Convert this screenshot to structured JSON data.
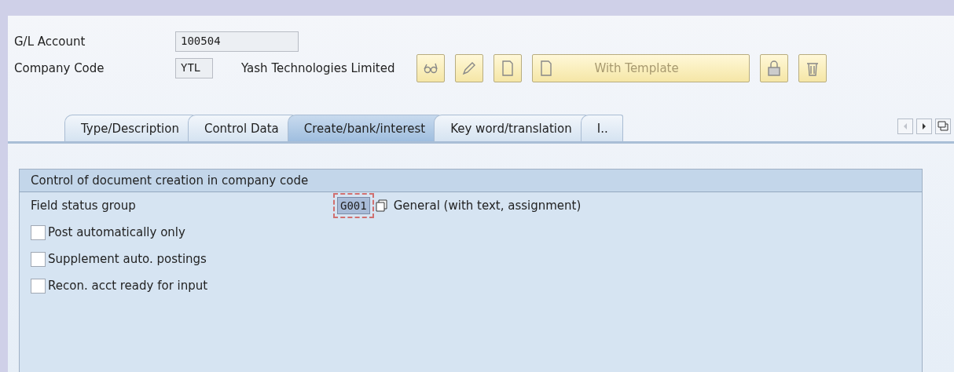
{
  "header": {
    "fields": [
      {
        "label": "G/L Account",
        "value": "100504",
        "kind": "long"
      },
      {
        "label": "Company Code",
        "value": "YTL",
        "kind": "short",
        "description": "Yash Technologies Limited"
      }
    ]
  },
  "toolbar": [
    {
      "kind": "display"
    },
    {
      "kind": "edit"
    },
    {
      "kind": "create"
    },
    {
      "kind": "template",
      "label": "With Template"
    },
    {
      "kind": "lock"
    },
    {
      "kind": "delete"
    }
  ],
  "tabs": [
    {
      "label": "Type/Description",
      "selected": false
    },
    {
      "label": "Control Data",
      "selected": false
    },
    {
      "label": "Create/bank/interest",
      "selected": true
    },
    {
      "label": "Key word/translation",
      "selected": false
    },
    {
      "label": "I..",
      "selected": false
    }
  ],
  "tab_nav": [
    {
      "kind": "prev",
      "disabled": true
    },
    {
      "kind": "next",
      "disabled": false
    },
    {
      "kind": "list",
      "disabled": false
    }
  ],
  "group": {
    "title": "Control of document creation in company code",
    "field": {
      "label": "Field status group",
      "value": "G001",
      "focused": true,
      "description": "General (with text, assignment)"
    },
    "checkboxes": [
      {
        "label": "Post automatically only",
        "checked": false
      },
      {
        "label": "Supplement auto. postings",
        "checked": false
      },
      {
        "label": "Recon. acct ready for input",
        "checked": false
      }
    ]
  }
}
